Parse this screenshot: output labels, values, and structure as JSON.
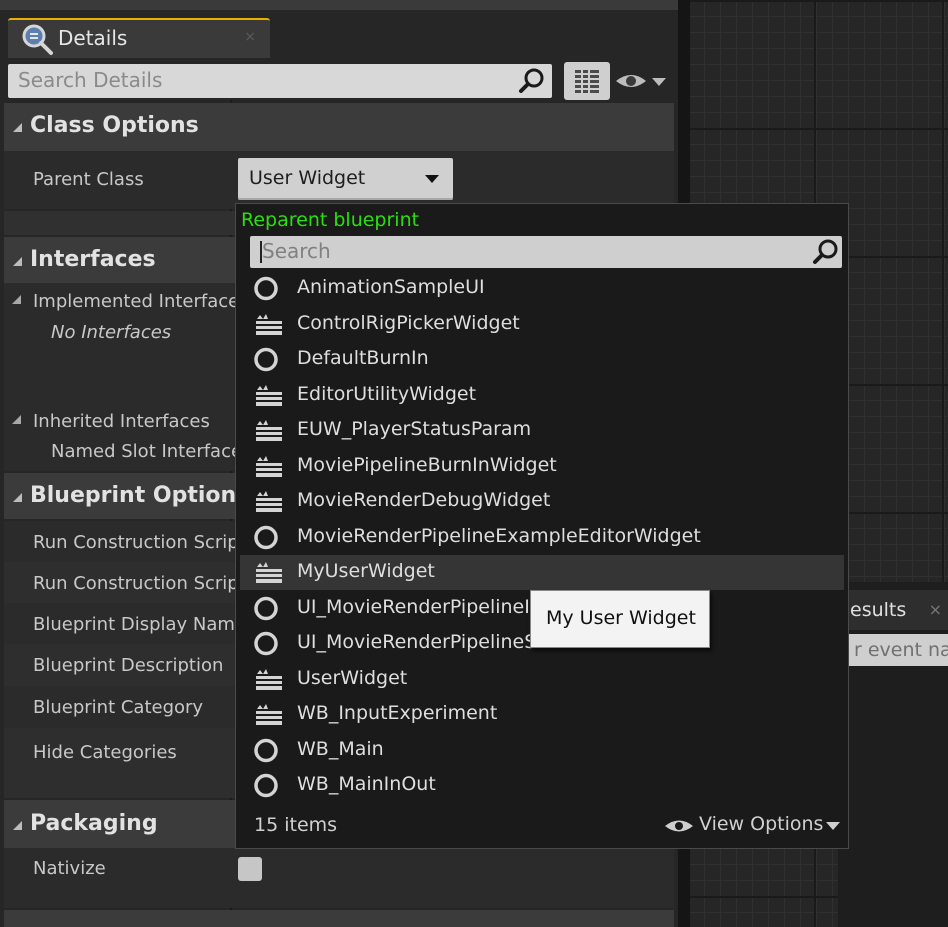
{
  "details_tab": {
    "title": "Details",
    "close": "×"
  },
  "search": {
    "placeholder": "Search Details"
  },
  "sections": {
    "class_options": {
      "title": "Class Options",
      "parent_class_label": "Parent Class",
      "parent_class_value": "User Widget"
    },
    "interfaces": {
      "title": "Interfaces",
      "implemented": "Implemented Interfaces",
      "no_interfaces": "No Interfaces",
      "inherited": "Inherited Interfaces",
      "named_slot": "Named Slot Interface"
    },
    "blueprint_options": {
      "title": "Blueprint Options",
      "rows": [
        "Run Construction Scrip",
        "Run Construction Scrip",
        "Blueprint Display Name",
        "Blueprint Description",
        "Blueprint Category",
        "Hide Categories"
      ]
    },
    "packaging": {
      "title": "Packaging",
      "nativize": "Nativize"
    }
  },
  "popup": {
    "title": "Reparent blueprint",
    "search_placeholder": "Search",
    "items": [
      {
        "name": "AnimationSampleUI",
        "icon": "circle-class-icon"
      },
      {
        "name": "ControlRigPickerWidget",
        "icon": "widget-class-icon"
      },
      {
        "name": "DefaultBurnIn",
        "icon": "circle-class-icon"
      },
      {
        "name": "EditorUtilityWidget",
        "icon": "widget-class-icon"
      },
      {
        "name": "EUW_PlayerStatusParam",
        "icon": "widget-class-icon"
      },
      {
        "name": "MoviePipelineBurnInWidget",
        "icon": "widget-class-icon"
      },
      {
        "name": "MovieRenderDebugWidget",
        "icon": "widget-class-icon"
      },
      {
        "name": "MovieRenderPipelineExampleEditorWidget",
        "icon": "circle-class-icon"
      },
      {
        "name": "MyUserWidget",
        "icon": "widget-class-icon"
      },
      {
        "name": "UI_MovieRenderPipelineI",
        "icon": "circle-class-icon"
      },
      {
        "name": "UI_MovieRenderPipelineS",
        "icon": "circle-class-icon"
      },
      {
        "name": "UserWidget",
        "icon": "widget-class-icon"
      },
      {
        "name": "WB_InputExperiment",
        "icon": "widget-class-icon"
      },
      {
        "name": "WB_Main",
        "icon": "circle-class-icon"
      },
      {
        "name": "WB_MainInOut",
        "icon": "circle-class-icon"
      }
    ],
    "selected_index": 8,
    "count_label": "15 items",
    "view_options": "View Options"
  },
  "tooltip": {
    "text": "My User Widget"
  },
  "find_panel": {
    "tab_title": "esults",
    "search_placeholder": "r event nan"
  },
  "colors": {
    "accent_tab": "#e8b000",
    "popup_title": "#29e00c"
  }
}
